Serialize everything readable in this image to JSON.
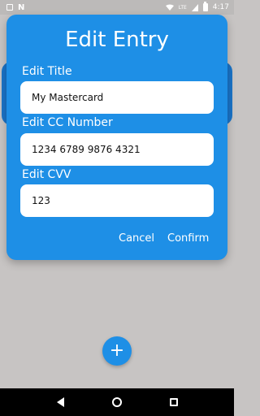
{
  "status_bar": {
    "time": "4:17",
    "network_label": "LTE",
    "icons": [
      "notification-icon",
      "n-app-icon",
      "wifi-icon",
      "signal-icon",
      "battery-icon"
    ]
  },
  "dialog": {
    "title": "Edit Entry",
    "fields": [
      {
        "label": "Edit Title",
        "value": "My Mastercard"
      },
      {
        "label": "Edit CC Number",
        "value": "1234 6789 9876 4321"
      },
      {
        "label": "Edit CVV",
        "value": "123"
      }
    ],
    "cancel_label": "Cancel",
    "confirm_label": "Confirm"
  },
  "fab": {
    "label": "+"
  },
  "colors": {
    "accent": "#1e8fe6",
    "background": "#c7c4c3",
    "status_bar": "#bcbab9",
    "nav_bar": "#000000"
  },
  "nav_bar": {
    "icons": [
      "back-icon",
      "home-icon",
      "recents-icon"
    ]
  }
}
